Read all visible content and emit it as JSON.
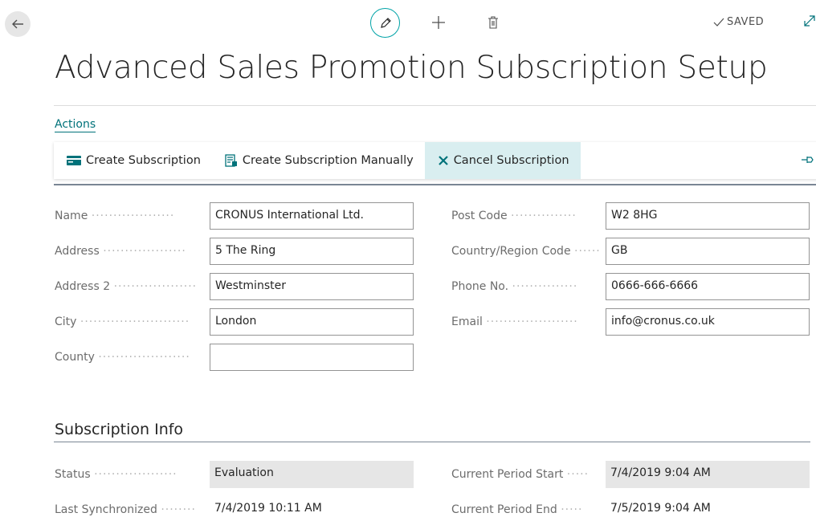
{
  "header": {
    "saved_label": "SAVED",
    "title": "Advanced Sales Promotion Subscription Setup",
    "actions_label": "Actions"
  },
  "icons": {
    "back": "arrow-left-icon",
    "edit": "pencil-icon",
    "new": "plus-icon",
    "delete": "trash-icon",
    "saved": "check-icon",
    "expand": "expand-icon",
    "pin": "pin-icon"
  },
  "colors": {
    "accent": "#00a3a7",
    "link": "#00727a",
    "active_action_bg": "#d9eef0",
    "readonly_bg": "#e6e6e6"
  },
  "actions": [
    {
      "label": "Create Subscription",
      "icon": "card-icon"
    },
    {
      "label": "Create Subscription Manually",
      "icon": "form-icon"
    },
    {
      "label": "Cancel Subscription",
      "icon": "x-icon"
    }
  ],
  "general": {
    "name": {
      "label": "Name",
      "value": "CRONUS International Ltd."
    },
    "address": {
      "label": "Address",
      "value": "5 The Ring"
    },
    "address2": {
      "label": "Address 2",
      "value": "Westminster"
    },
    "city": {
      "label": "City",
      "value": "London"
    },
    "county": {
      "label": "County",
      "value": ""
    },
    "post_code": {
      "label": "Post Code",
      "value": "W2 8HG"
    },
    "country": {
      "label": "Country/Region Code",
      "value": "GB"
    },
    "phone": {
      "label": "Phone No.",
      "value": "0666-666-6666"
    },
    "email": {
      "label": "Email",
      "value": "info@cronus.co.uk"
    }
  },
  "subscription": {
    "section_title": "Subscription Info",
    "status": {
      "label": "Status",
      "value": "Evaluation"
    },
    "last_sync": {
      "label": "Last Synchronized",
      "value": "7/4/2019 10:11 AM"
    },
    "period_start": {
      "label": "Current Period Start",
      "value": "7/4/2019 9:04 AM"
    },
    "period_end": {
      "label": "Current Period End",
      "value": "7/5/2019 9:04 AM"
    }
  }
}
